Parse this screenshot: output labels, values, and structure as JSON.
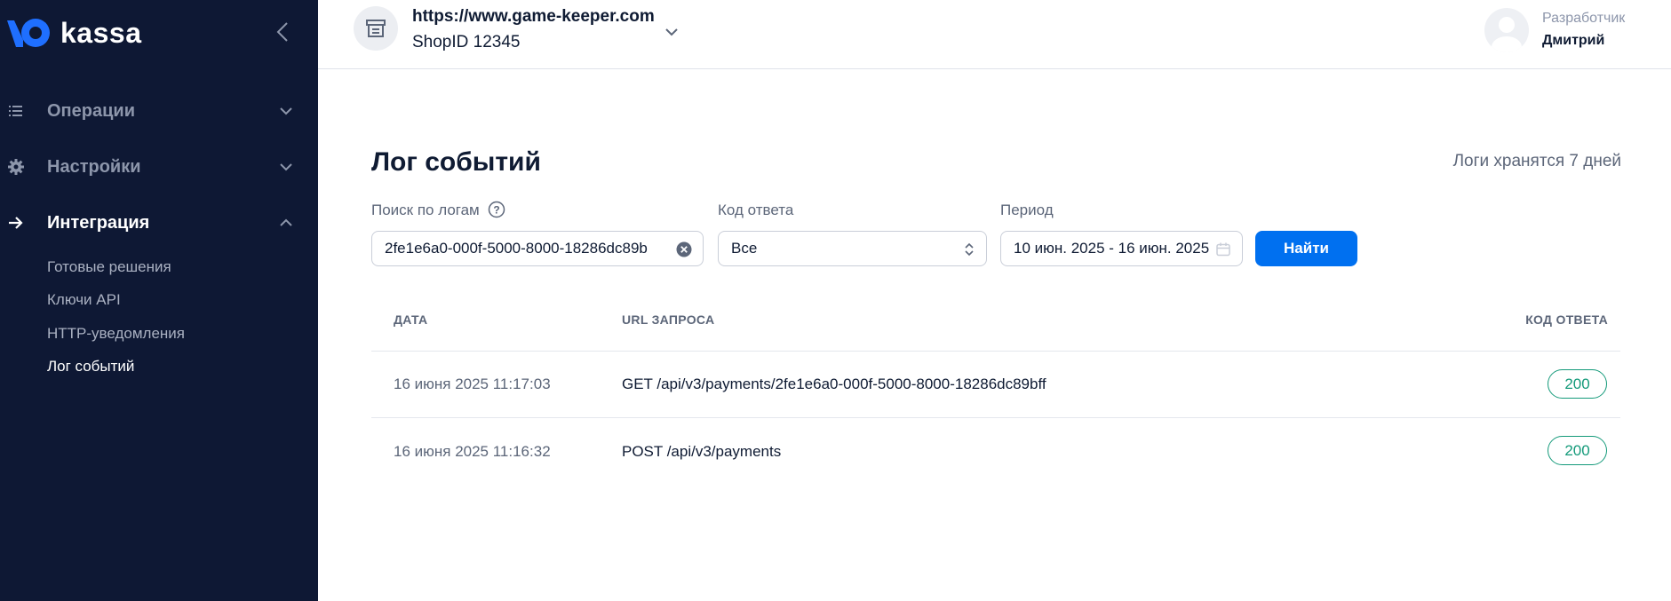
{
  "brand": {
    "logo_text": "kassa"
  },
  "sidebar": {
    "sections": [
      {
        "label": "Операции",
        "icon": "list-icon",
        "expanded": false
      },
      {
        "label": "Настройки",
        "icon": "gear-icon",
        "expanded": false
      },
      {
        "label": "Интеграция",
        "icon": "arrow-right-icon",
        "expanded": true
      }
    ],
    "sub_items": [
      {
        "label": "Готовые решения",
        "active": false
      },
      {
        "label": "Ключи API",
        "active": false
      },
      {
        "label": "HTTP-уведомления",
        "active": false
      },
      {
        "label": "Лог событий",
        "active": true
      }
    ]
  },
  "header": {
    "shop_url": "https://www.game-keeper.com",
    "shop_id": "ShopID 12345",
    "user_role": "Разработчик",
    "user_name": "Дмитрий"
  },
  "main": {
    "title": "Лог событий",
    "retention_note": "Логи хранятся 7 дней",
    "filters": {
      "search_label": "Поиск по логам",
      "search_value": "2fe1e6a0-000f-5000-8000-18286dc89b",
      "response_code_label": "Код ответа",
      "response_code_value": "Все",
      "period_label": "Период",
      "period_value": "10 июн. 2025 - 16 июн. 2025",
      "find_button": "Найти"
    },
    "table": {
      "columns": [
        "ДАТА",
        "URL ЗАПРОСА",
        "КОД ОТВЕТА"
      ],
      "rows": [
        {
          "date": "16 июня 2025 11:17:03",
          "url": "GET /api/v3/payments/2fe1e6a0-000f-5000-8000-18286dc89bff",
          "code": "200"
        },
        {
          "date": "16 июня 2025 11:16:32",
          "url": "POST /api/v3/payments",
          "code": "200"
        }
      ]
    }
  },
  "colors": {
    "sidebar_bg": "#0e1834",
    "accent_blue": "#0070f0",
    "success_green": "#149a7a"
  }
}
